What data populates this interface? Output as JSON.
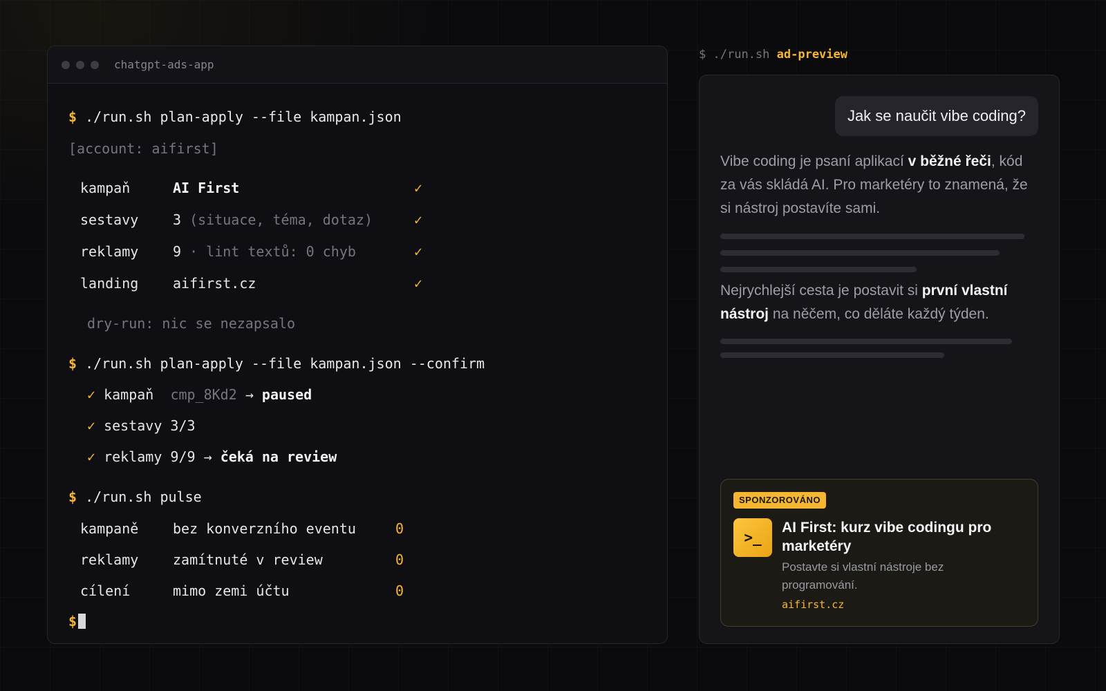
{
  "terminal": {
    "title": "chatgpt-ads-app",
    "prompt": "$",
    "cmd1": "./run.sh plan-apply --file kampan.json",
    "account": "[account: aifirst]",
    "plan": [
      {
        "key": "kampaň",
        "value": "AI First",
        "note": "",
        "check": "✓"
      },
      {
        "key": "sestavy",
        "value": "3",
        "note": "(situace, téma, dotaz)",
        "check": "✓"
      },
      {
        "key": "reklamy",
        "value": "9",
        "note": "· lint textů: 0 chyb",
        "check": "✓"
      },
      {
        "key": "landing",
        "value": "aifirst.cz",
        "note": "",
        "check": "✓"
      }
    ],
    "dry_run": "dry-run: nic se nezapsalo",
    "cmd2": "./run.sh plan-apply --file kampan.json --confirm",
    "results": [
      {
        "check": "✓",
        "label": "kampaň",
        "id": "cmp_8Kd2",
        "arrow": "→",
        "status": "paused"
      },
      {
        "check": "✓",
        "label": "sestavy 3/3",
        "id": "",
        "arrow": "",
        "status": ""
      },
      {
        "check": "✓",
        "label": "reklamy 9/9",
        "id": "",
        "arrow": "→",
        "status": "čeká na review"
      }
    ],
    "cmd3": "./run.sh pulse",
    "pulse": [
      {
        "key": "kampaně",
        "desc": "bez konverzního eventu",
        "count": "0"
      },
      {
        "key": "reklamy",
        "desc": "zamítnuté v review",
        "count": "0"
      },
      {
        "key": "cílení",
        "desc": "mimo zemi účtu",
        "count": "0"
      }
    ]
  },
  "preview": {
    "prompt": "$",
    "command": "./run.sh",
    "arg": "ad-preview",
    "question": "Jak se naučit vibe coding?",
    "para1": {
      "a": "Vibe coding je psaní aplikací ",
      "b": "v běžné řeči",
      "c": ", kód za vás skládá AI. Pro marketéry to znamená, že si nástroj postavíte sami."
    },
    "para2": {
      "a": "Nejrychlejší cesta je postavit si ",
      "b": "první vlastní nástroj",
      "c": " na něčem, co děláte každý týden."
    },
    "ad": {
      "badge": "SPONZOROVÁNO",
      "icon": ">_",
      "title": "AI First: kurz vibe codingu pro marketéry",
      "description": "Postavte si vlastní nástroje bez programování.",
      "url": "aifirst.cz"
    }
  },
  "colors": {
    "accent": "#f5b731",
    "background": "#0b0b0e",
    "panel": "#151519"
  }
}
